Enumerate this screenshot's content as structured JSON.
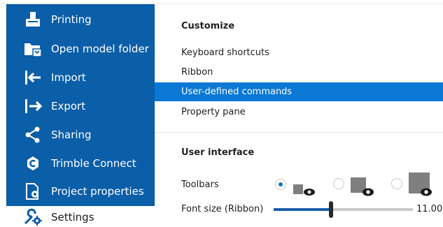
{
  "sidebar": {
    "items": [
      {
        "label": "Printing",
        "icon": "printer-icon"
      },
      {
        "label": "Open model folder",
        "icon": "folder-open-icon"
      },
      {
        "label": "Import",
        "icon": "import-arrow-icon"
      },
      {
        "label": "Export",
        "icon": "export-arrow-icon"
      },
      {
        "label": "Sharing",
        "icon": "share-icon"
      },
      {
        "label": "Trimble Connect",
        "icon": "trimble-connect-icon"
      },
      {
        "label": "Project properties",
        "icon": "project-properties-icon"
      },
      {
        "label": "Settings",
        "icon": "settings-wrench-gear-icon",
        "active": true
      }
    ],
    "background": "#0b5ea8"
  },
  "customize": {
    "title": "Customize",
    "options": [
      {
        "label": "Keyboard shortcuts"
      },
      {
        "label": "Ribbon"
      },
      {
        "label": "User-defined commands",
        "selected": true
      },
      {
        "label": "Property pane"
      }
    ],
    "accent": "#0a78d4"
  },
  "user_interface": {
    "title": "User interface",
    "toolbars": {
      "label": "Toolbars",
      "choices": [
        "small",
        "medium",
        "large"
      ],
      "selected": "small"
    },
    "font_size": {
      "label": "Font size (Ribbon)",
      "value": "11.00",
      "level_fraction": 0.41
    }
  }
}
